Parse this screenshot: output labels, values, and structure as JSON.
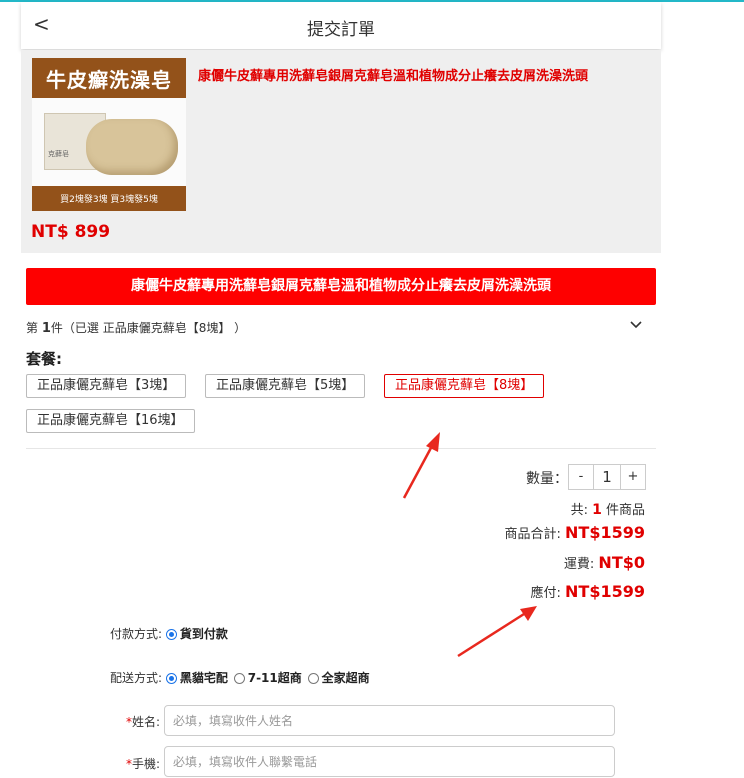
{
  "header": {
    "back_label": "<",
    "title": "提交訂單"
  },
  "product": {
    "image_banner_top": "牛皮癬洗澡皂",
    "image_banner_bottom": "買2塊發3塊 買3塊發5塊",
    "image_box_text": "克藓皂",
    "name": "康儷牛皮蘚專用洗蘚皂銀屑克蘚皂溫和植物成分止癢去皮屑洗澡洗頭",
    "price": "NT$ 899"
  },
  "banner": {
    "text": "康儷牛皮蘚專用洗蘚皂銀屑克蘚皂溫和植物成分止癢去皮屑洗澡洗頭"
  },
  "item_line": {
    "prefix": "第 ",
    "index": "1",
    "suffix": "件（已選 正品康儷克蘚皂【8塊】 ）"
  },
  "package": {
    "label": "套餐:",
    "options": [
      "正品康儷克蘚皂【3塊】",
      "正品康儷克蘚皂【5塊】",
      "正品康儷克蘚皂【8塊】",
      "正品康儷克蘚皂【16塊】"
    ],
    "selected_index": 2
  },
  "quantity": {
    "label": "數量：",
    "minus": "-",
    "value": "1",
    "plus": "+"
  },
  "summary": {
    "count_prefix": "共: ",
    "count": "1",
    "count_suffix": " 件商品",
    "subtotal_label": "商品合計: ",
    "subtotal_value": "NT$1599",
    "shipping_label": "運費: ",
    "shipping_value": "NT$0",
    "payable_label": "應付: ",
    "payable_value": "NT$1599"
  },
  "payment": {
    "label": "付款方式:",
    "option": "貨到付款"
  },
  "delivery": {
    "label": "配送方式:",
    "options": [
      "黑貓宅配",
      "7-11超商",
      "全家超商"
    ],
    "selected_index": 0
  },
  "form": {
    "required_mark": "*",
    "name_label": "姓名:",
    "name_placeholder": "必填，填寫收件人姓名",
    "phone_label": "手機:",
    "phone_placeholder": "必填，填寫收件人聯繫電話"
  },
  "colors": {
    "accent_red": "#fe0000",
    "price_red": "#e00000",
    "radio_blue": "#1a73e8",
    "arrow_red": "#e8281e"
  }
}
